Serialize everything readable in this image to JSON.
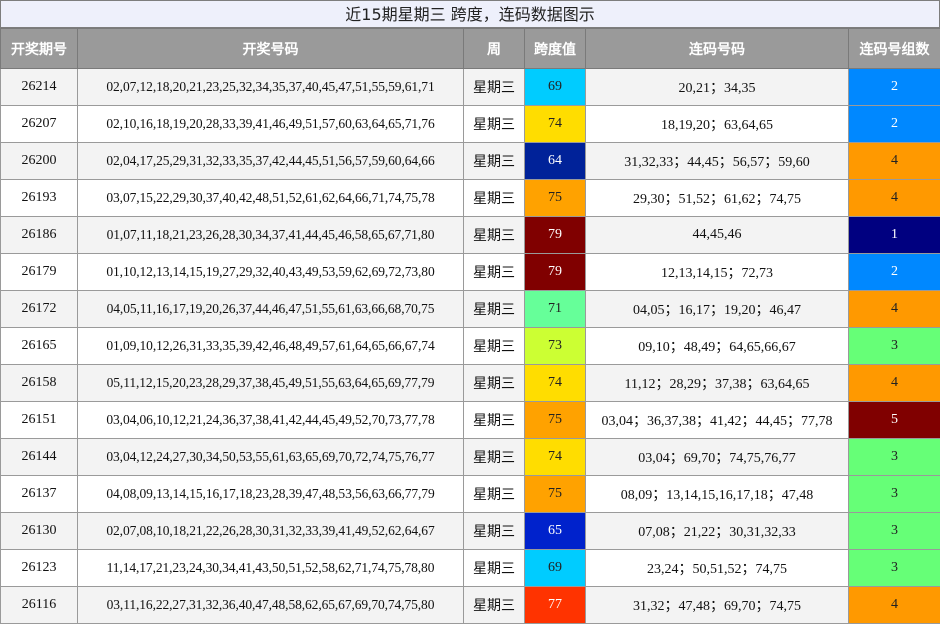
{
  "title": "近15期星期三 跨度，连码数据图示",
  "headers": [
    "开奖期号",
    "开奖号码",
    "周",
    "跨度值",
    "连码号码",
    "连码号组数"
  ],
  "rows": [
    {
      "issue": "26214",
      "numbers": "02,07,12,18,20,21,23,25,32,34,35,37,40,45,47,51,55,59,61,71",
      "week": "星期三",
      "span": "69",
      "span_bg": "#00ccff",
      "span_fg": "#222222",
      "consecutive": "20,21；34,35",
      "groups": "2",
      "groups_bg": "#0088ff",
      "groups_fg": "#ffffff"
    },
    {
      "issue": "26207",
      "numbers": "02,10,16,18,19,20,28,33,39,41,46,49,51,57,60,63,64,65,71,76",
      "week": "星期三",
      "span": "74",
      "span_bg": "#ffdd00",
      "span_fg": "#222222",
      "consecutive": "18,19,20；63,64,65",
      "groups": "2",
      "groups_bg": "#0088ff",
      "groups_fg": "#ffffff"
    },
    {
      "issue": "26200",
      "numbers": "02,04,17,25,29,31,32,33,35,37,42,44,45,51,56,57,59,60,64,66",
      "week": "星期三",
      "span": "64",
      "span_bg": "#002299",
      "span_fg": "#ffffff",
      "consecutive": "31,32,33；44,45；56,57；59,60",
      "groups": "4",
      "groups_bg": "#ff9900",
      "groups_fg": "#222222"
    },
    {
      "issue": "26193",
      "numbers": "03,07,15,22,29,30,37,40,42,48,51,52,61,62,64,66,71,74,75,78",
      "week": "星期三",
      "span": "75",
      "span_bg": "#ffa200",
      "span_fg": "#222222",
      "consecutive": "29,30；51,52；61,62；74,75",
      "groups": "4",
      "groups_bg": "#ff9900",
      "groups_fg": "#222222"
    },
    {
      "issue": "26186",
      "numbers": "01,07,11,18,21,23,26,28,30,34,37,41,44,45,46,58,65,67,71,80",
      "week": "星期三",
      "span": "79",
      "span_bg": "#800000",
      "span_fg": "#ffffff",
      "consecutive": "44,45,46",
      "groups": "1",
      "groups_bg": "#000080",
      "groups_fg": "#ffffff"
    },
    {
      "issue": "26179",
      "numbers": "01,10,12,13,14,15,19,27,29,32,40,43,49,53,59,62,69,72,73,80",
      "week": "星期三",
      "span": "79",
      "span_bg": "#800000",
      "span_fg": "#ffffff",
      "consecutive": "12,13,14,15；72,73",
      "groups": "2",
      "groups_bg": "#0088ff",
      "groups_fg": "#ffffff"
    },
    {
      "issue": "26172",
      "numbers": "04,05,11,16,17,19,20,26,37,44,46,47,51,55,61,63,66,68,70,75",
      "week": "星期三",
      "span": "71",
      "span_bg": "#66ff99",
      "span_fg": "#222222",
      "consecutive": "04,05；16,17；19,20；46,47",
      "groups": "4",
      "groups_bg": "#ff9900",
      "groups_fg": "#222222"
    },
    {
      "issue": "26165",
      "numbers": "01,09,10,12,26,31,33,35,39,42,46,48,49,57,61,64,65,66,67,74",
      "week": "星期三",
      "span": "73",
      "span_bg": "#ccff33",
      "span_fg": "#222222",
      "consecutive": "09,10；48,49；64,65,66,67",
      "groups": "3",
      "groups_bg": "#66ff77",
      "groups_fg": "#222222"
    },
    {
      "issue": "26158",
      "numbers": "05,11,12,15,20,23,28,29,37,38,45,49,51,55,63,64,65,69,77,79",
      "week": "星期三",
      "span": "74",
      "span_bg": "#ffdd00",
      "span_fg": "#222222",
      "consecutive": "11,12；28,29；37,38；63,64,65",
      "groups": "4",
      "groups_bg": "#ff9900",
      "groups_fg": "#222222"
    },
    {
      "issue": "26151",
      "numbers": "03,04,06,10,12,21,24,36,37,38,41,42,44,45,49,52,70,73,77,78",
      "week": "星期三",
      "span": "75",
      "span_bg": "#ffa200",
      "span_fg": "#222222",
      "consecutive": "03,04；36,37,38；41,42；44,45；77,78",
      "groups": "5",
      "groups_bg": "#800000",
      "groups_fg": "#ffffff"
    },
    {
      "issue": "26144",
      "numbers": "03,04,12,24,27,30,34,50,53,55,61,63,65,69,70,72,74,75,76,77",
      "week": "星期三",
      "span": "74",
      "span_bg": "#ffdd00",
      "span_fg": "#222222",
      "consecutive": "03,04；69,70；74,75,76,77",
      "groups": "3",
      "groups_bg": "#66ff77",
      "groups_fg": "#222222"
    },
    {
      "issue": "26137",
      "numbers": "04,08,09,13,14,15,16,17,18,23,28,39,47,48,53,56,63,66,77,79",
      "week": "星期三",
      "span": "75",
      "span_bg": "#ffa200",
      "span_fg": "#222222",
      "consecutive": "08,09；13,14,15,16,17,18；47,48",
      "groups": "3",
      "groups_bg": "#66ff77",
      "groups_fg": "#222222"
    },
    {
      "issue": "26130",
      "numbers": "02,07,08,10,18,21,22,26,28,30,31,32,33,39,41,49,52,62,64,67",
      "week": "星期三",
      "span": "65",
      "span_bg": "#0022cc",
      "span_fg": "#ffffff",
      "consecutive": "07,08；21,22；30,31,32,33",
      "groups": "3",
      "groups_bg": "#66ff77",
      "groups_fg": "#222222"
    },
    {
      "issue": "26123",
      "numbers": "11,14,17,21,23,24,30,34,41,43,50,51,52,58,62,71,74,75,78,80",
      "week": "星期三",
      "span": "69",
      "span_bg": "#00ccff",
      "span_fg": "#222222",
      "consecutive": "23,24；50,51,52；74,75",
      "groups": "3",
      "groups_bg": "#66ff77",
      "groups_fg": "#222222"
    },
    {
      "issue": "26116",
      "numbers": "03,11,16,22,27,31,32,36,40,47,48,58,62,65,67,69,70,74,75,80",
      "week": "星期三",
      "span": "77",
      "span_bg": "#ff3300",
      "span_fg": "#ffffff",
      "consecutive": "31,32；47,48；69,70；74,75",
      "groups": "4",
      "groups_bg": "#ff9900",
      "groups_fg": "#222222"
    }
  ]
}
